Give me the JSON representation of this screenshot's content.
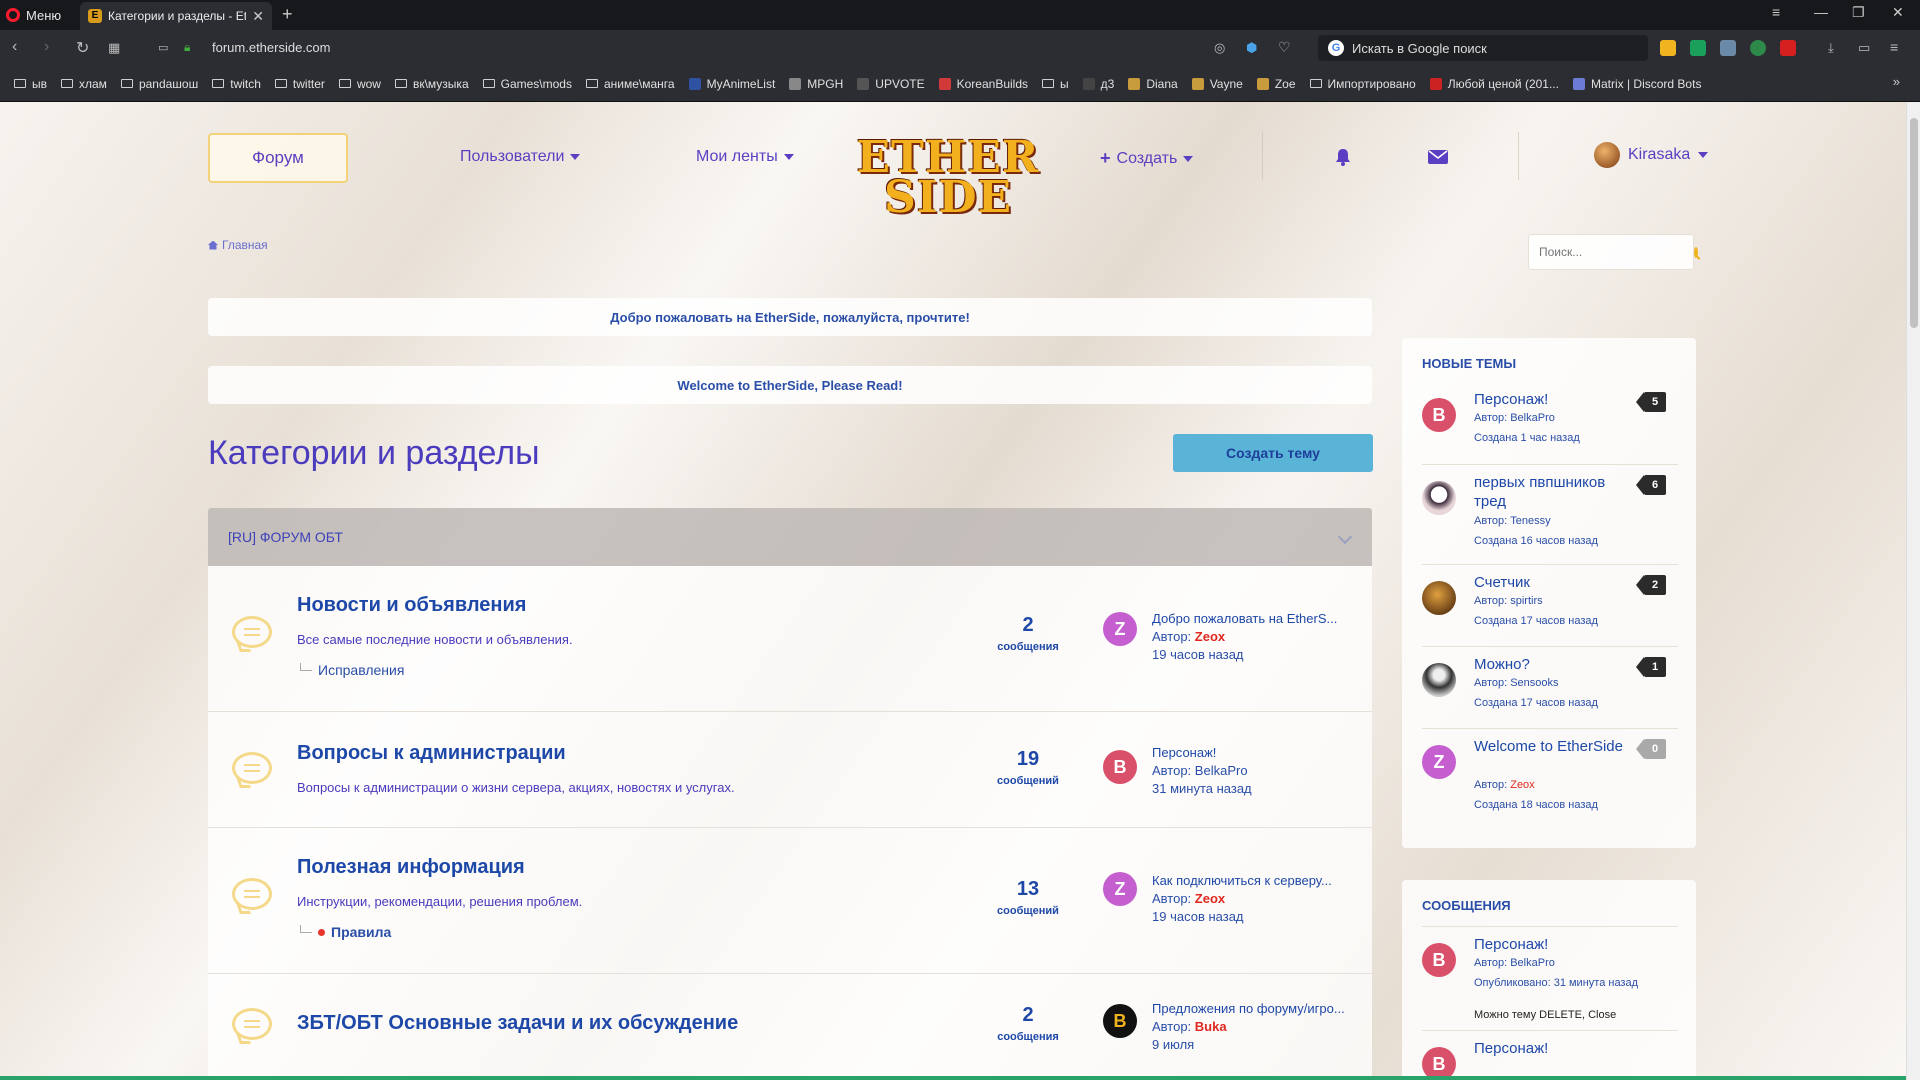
{
  "browser": {
    "menu_label": "Меню",
    "tab_title": "Категории и разделы - Eth",
    "url": "forum.etherside.com",
    "search_placeholder": "Искать в Google поиск",
    "bookmarks": [
      {
        "label": "ыв",
        "type": "folder"
      },
      {
        "label": "хлам",
        "type": "folder"
      },
      {
        "label": "pandaшош",
        "type": "folder"
      },
      {
        "label": "twitch",
        "type": "folder"
      },
      {
        "label": "twitter",
        "type": "folder"
      },
      {
        "label": "wow",
        "type": "folder"
      },
      {
        "label": "вк\\музыка",
        "type": "folder"
      },
      {
        "label": "Games\\mods",
        "type": "folder"
      },
      {
        "label": "аниме\\манга",
        "type": "folder"
      },
      {
        "label": "MyAnimeList",
        "type": "site",
        "color": "#2e51a2"
      },
      {
        "label": "MPGH",
        "type": "site",
        "color": "#888888"
      },
      {
        "label": "UPVOTE",
        "type": "site",
        "color": "#555555"
      },
      {
        "label": "KoreanBuilds",
        "type": "site",
        "color": "#d23a3a"
      },
      {
        "label": "ы",
        "type": "folder"
      },
      {
        "label": "д3",
        "type": "site",
        "color": "#444444"
      },
      {
        "label": "Diana",
        "type": "site",
        "color": "#c89b3c"
      },
      {
        "label": "Vayne",
        "type": "site",
        "color": "#c89b3c"
      },
      {
        "label": "Zoe",
        "type": "site",
        "color": "#c89b3c"
      },
      {
        "label": "Импортировано",
        "type": "folder"
      },
      {
        "label": "Любой ценой (201...",
        "type": "site",
        "color": "#cc2222"
      },
      {
        "label": "Matrix | Discord Bots",
        "type": "site",
        "color": "#6b7bd6"
      }
    ]
  },
  "nav": {
    "forum": "Форум",
    "users": "Пользователи",
    "feeds": "Мои ленты",
    "logo_line1": "ETHER",
    "logo_line2": "SIDE",
    "create": "Создать",
    "username": "Kirasaka"
  },
  "breadcrumb": "Главная",
  "search_placeholder": "Поиск...",
  "notices": [
    "Добро пожаловать на EtherSide, пожалуйста, прочтите!",
    "Welcome to EtherSide, Please Read!"
  ],
  "page_title": "Категории и разделы",
  "create_topic": "Создать тему",
  "category": "[RU] ФОРУМ ОБТ",
  "forums": [
    {
      "title": "Новости и объявления",
      "desc": "Все самые последние новости и объявления.",
      "sub": "Исправления",
      "sub_dot": false,
      "count": "2",
      "count_label": "сообщения",
      "last_title": "Добро пожаловать на EtherS...",
      "author_prefix": "Автор:",
      "author": "Zeox",
      "author_red": true,
      "time": "19 часов назад",
      "av_letter": "Z",
      "av_color": "#c55fd0"
    },
    {
      "title": "Вопросы к администрации",
      "desc": "Вопросы к администрации о жизни сервера, акциях, новостях и услугах.",
      "sub": "",
      "sub_dot": false,
      "count": "19",
      "count_label": "сообщений",
      "last_title": "Персонаж!",
      "author_prefix": "Автор:",
      "author": "BelkaPro",
      "author_red": false,
      "time": "31 минута назад",
      "av_letter": "B",
      "av_color": "#d9506a"
    },
    {
      "title": "Полезная информация",
      "desc": "Инструкции, рекомендации, решения проблем.",
      "sub": "Правила",
      "sub_dot": true,
      "count": "13",
      "count_label": "сообщений",
      "last_title": "Как подключиться к серверу...",
      "author_prefix": "Автор:",
      "author": "Zeox",
      "author_red": true,
      "time": "19 часов назад",
      "av_letter": "Z",
      "av_color": "#c55fd0"
    },
    {
      "title": "ЗБТ/ОБТ Основные задачи и их обсуждение",
      "desc": "",
      "sub": "",
      "sub_dot": false,
      "count": "2",
      "count_label": "сообщения",
      "last_title": "Предложения по форуму/игро...",
      "author_prefix": "Автор:",
      "author": "Buka",
      "author_red": true,
      "time": "9 июля",
      "av_letter": "B",
      "av_color": "#111111"
    }
  ],
  "sidebar": {
    "new_topics_title": "НОВЫЕ ТЕМЫ",
    "new_topics": [
      {
        "title": "Персонаж!",
        "author_prefix": "Автор:",
        "author": "BelkaPro",
        "author_red": false,
        "created": "Создана 1 час назад",
        "count": "5",
        "av_letter": "B",
        "av_color": "#d9506a"
      },
      {
        "title": "первых пвпшников тред",
        "author_prefix": "Автор:",
        "author": "Tenessy",
        "author_red": false,
        "created": "Создана 16 часов назад",
        "count": "6",
        "av_letter": "",
        "av_color": "#e9d7d7"
      },
      {
        "title": "Счетчик",
        "author_prefix": "Автор:",
        "author": "spirtirs",
        "author_red": false,
        "created": "Создана 17 часов назад",
        "count": "2",
        "av_letter": "",
        "av_color": "#7a4a1a"
      },
      {
        "title": "Можно?",
        "author_prefix": "Автор:",
        "author": "Sensooks",
        "author_red": false,
        "created": "Создана 17 часов назад",
        "count": "1",
        "av_letter": "",
        "av_color": "#bcbcbc"
      },
      {
        "title": "Welcome to EtherSide",
        "author_prefix": "Автор:",
        "author": "Zeox",
        "author_red": true,
        "created": "Создана 18 часов назад",
        "count": "0",
        "av_letter": "Z",
        "av_color": "#c55fd0"
      }
    ],
    "messages_title": "СООБЩЕНИЯ",
    "messages": [
      {
        "title": "Персонаж!",
        "author_prefix": "Автор:",
        "author": "BelkaPro",
        "posted": "Опубликовано: 31 минута назад",
        "quote": "Можно тему DELETE, Close",
        "av_letter": "B",
        "av_color": "#d9506a"
      },
      {
        "title": "Персонаж!",
        "av_letter": "B",
        "av_color": "#d9506a"
      }
    ]
  }
}
